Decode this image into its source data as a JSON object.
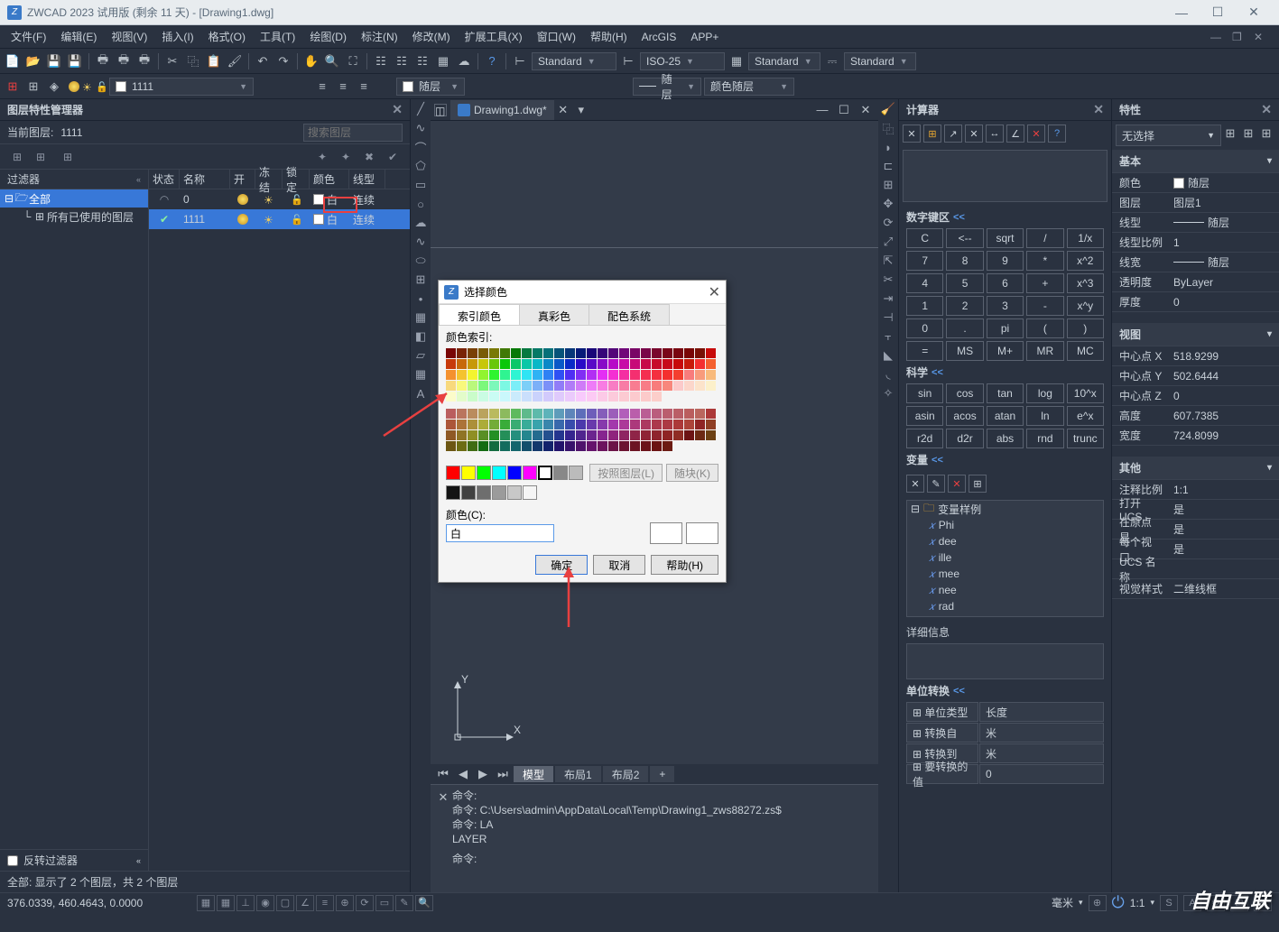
{
  "titlebar": {
    "title": "ZWCAD 2023 试用版 (剩余 11 天) - [Drawing1.dwg]"
  },
  "menubar": [
    "文件(F)",
    "编辑(E)",
    "视图(V)",
    "插入(I)",
    "格式(O)",
    "工具(T)",
    "绘图(D)",
    "标注(N)",
    "修改(M)",
    "扩展工具(X)",
    "窗口(W)",
    "帮助(H)",
    "ArcGIS",
    "APP+"
  ],
  "topcombos": {
    "std1": "Standard",
    "iso": "ISO-25",
    "std2": "Standard",
    "std3": "Standard"
  },
  "secbar": {
    "layer": "1111",
    "bylayer": "随层",
    "bylayer2": "随层",
    "bycolor": "颜色随层"
  },
  "layerpanel": {
    "title": "图层特性管理器",
    "current_label": "当前图层:",
    "current_value": "1111",
    "search_ph": "搜索图层",
    "filter_head": "过滤器",
    "tree_all": "全部",
    "tree_used": "所有已使用的图层",
    "cols": {
      "status": "状态",
      "name": "名称",
      "on": "开",
      "freeze": "冻结",
      "lock": "锁定",
      "color": "颜色",
      "ltype": "线型"
    },
    "rows": [
      {
        "name": "0",
        "color": "白",
        "ltype": "连续"
      },
      {
        "name": "1111",
        "color": "白",
        "ltype": "连续"
      }
    ],
    "invert": "反转过滤器",
    "footer": "全部: 显示了 2 个图层，共 2 个图层"
  },
  "doctab": "Drawing1.dwg*",
  "modeltabs": {
    "model": "模型",
    "layout1": "布局1",
    "layout2": "布局2",
    "add": "+"
  },
  "cmd": {
    "l1": "命令:",
    "l2": "命令: C:\\Users\\admin\\AppData\\Local\\Temp\\Drawing1_zws88272.zs$",
    "l3": "命令: LA",
    "l4": "LAYER",
    "l5": "命令:"
  },
  "calc": {
    "title": "计算器",
    "numsec": "数字键区",
    "scisec": "科学",
    "varsec": "变量",
    "detail": "详细信息",
    "unitsec": "单位转换",
    "keys": [
      [
        "C",
        "<--",
        "sqrt",
        "/",
        "1/x"
      ],
      [
        "7",
        "8",
        "9",
        "*",
        "x^2"
      ],
      [
        "4",
        "5",
        "6",
        "+",
        "x^3"
      ],
      [
        "1",
        "2",
        "3",
        "-",
        "x^y"
      ],
      [
        "0",
        ".",
        "pi",
        "(",
        ")"
      ],
      [
        "=",
        "MS",
        "M+",
        "MR",
        "MC"
      ]
    ],
    "scikeys": [
      [
        "sin",
        "cos",
        "tan",
        "log",
        "10^x"
      ],
      [
        "asin",
        "acos",
        "atan",
        "ln",
        "e^x"
      ],
      [
        "r2d",
        "d2r",
        "abs",
        "rnd",
        "trunc"
      ]
    ],
    "vars": {
      "folder": "变量样例",
      "items": [
        "Phi",
        "dee",
        "ille",
        "mee",
        "nee",
        "rad"
      ]
    },
    "units": [
      [
        "单位类型",
        "长度"
      ],
      [
        "转换自",
        "米"
      ],
      [
        "转换到",
        "米"
      ],
      [
        "要转换的值",
        "0"
      ]
    ]
  },
  "props": {
    "title": "特性",
    "nosel": "无选择",
    "groups": {
      "basic": {
        "label": "基本",
        "rows": [
          [
            "颜色",
            "随层"
          ],
          [
            "图层",
            "图层1"
          ],
          [
            "线型",
            "随层"
          ],
          [
            "线型比例",
            "1"
          ],
          [
            "线宽",
            "随层"
          ],
          [
            "透明度",
            "ByLayer"
          ],
          [
            "厚度",
            "0"
          ]
        ]
      },
      "view": {
        "label": "视图",
        "rows": [
          [
            "中心点 X",
            "518.9299"
          ],
          [
            "中心点 Y",
            "502.6444"
          ],
          [
            "中心点 Z",
            "0"
          ],
          [
            "高度",
            "607.7385"
          ],
          [
            "宽度",
            "724.8099"
          ]
        ]
      },
      "other": {
        "label": "其他",
        "rows": [
          [
            "注释比例",
            "1:1"
          ],
          [
            "打开 UCS...",
            "是"
          ],
          [
            "在原点显...",
            "是"
          ],
          [
            "每个视口...",
            "是"
          ],
          [
            "UCS 名称",
            ""
          ],
          [
            "视觉样式",
            "二维线框"
          ]
        ]
      }
    }
  },
  "dialog": {
    "title": "选择颜色",
    "tabs": [
      "索引颜色",
      "真彩色",
      "配色系统"
    ],
    "index_label": "颜色索引:",
    "bylayer": "按照图层(L)",
    "byblock": "随块(K)",
    "color_label": "颜色(C):",
    "color_value": "白",
    "ok": "确定",
    "cancel": "取消",
    "help": "帮助(H)"
  },
  "status": {
    "coords": "376.0339, 460.4643, 0.0000",
    "mm": "毫米",
    "scale": "1:1"
  },
  "watermark": "自由互联"
}
